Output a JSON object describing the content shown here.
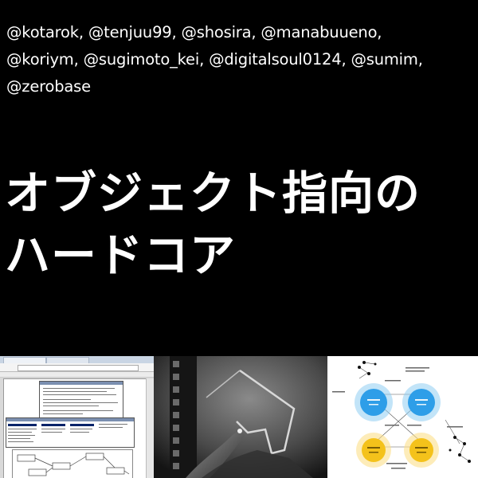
{
  "credits": {
    "line1": "@kotarok, @tenjuu99, @shosira, @manabuueno,",
    "line2": "@koriym, @sugimoto_kei, @digitalsoul0124, @sumim,",
    "line3": "@zerobase"
  },
  "title": {
    "line1": "オブジェクト指向の",
    "line2": "ハードコア"
  },
  "colors": {
    "background": "#000000",
    "text": "#ffffff",
    "diagram_blue": "#2e9ee8",
    "diagram_yellow": "#f4c21b"
  },
  "thumbnails": [
    {
      "kind": "browser-screenshot"
    },
    {
      "kind": "video-still"
    },
    {
      "kind": "concept-diagram"
    }
  ]
}
